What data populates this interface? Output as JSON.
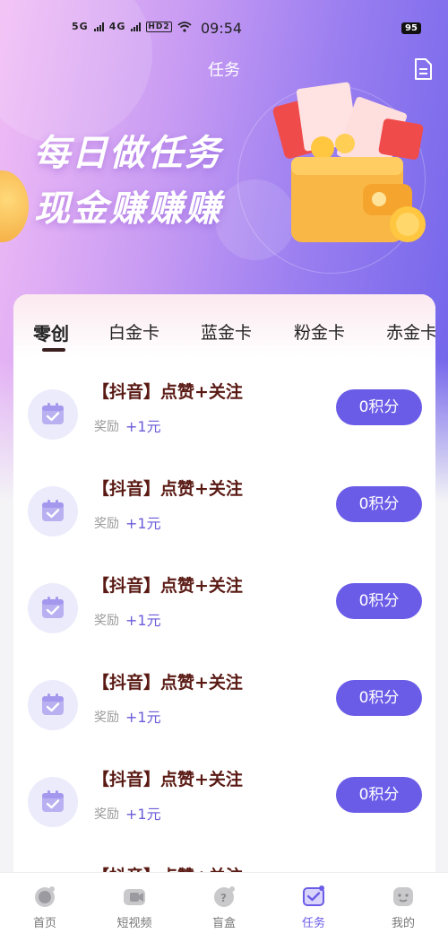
{
  "status_bar": {
    "time": "09:54",
    "network": [
      "5G",
      "4G",
      "HD2"
    ],
    "battery": "95"
  },
  "header": {
    "title": "任务",
    "doc_icon": "document-icon"
  },
  "hero": {
    "line1": "每日做任务",
    "line2": "现金赚赚赚"
  },
  "tabs": [
    {
      "label": "零创",
      "active": true
    },
    {
      "label": "白金卡",
      "active": false
    },
    {
      "label": "蓝金卡",
      "active": false
    },
    {
      "label": "粉金卡",
      "active": false
    },
    {
      "label": "赤金卡",
      "active": false
    }
  ],
  "tasks": [
    {
      "title": "【抖音】点赞+关注",
      "reward_label": "奖励",
      "reward_value": "+1元",
      "button": "0积分"
    },
    {
      "title": "【抖音】点赞+关注",
      "reward_label": "奖励",
      "reward_value": "+1元",
      "button": "0积分"
    },
    {
      "title": "【抖音】点赞+关注",
      "reward_label": "奖励",
      "reward_value": "+1元",
      "button": "0积分"
    },
    {
      "title": "【抖音】点赞+关注",
      "reward_label": "奖励",
      "reward_value": "+1元",
      "button": "0积分"
    },
    {
      "title": "【抖音】点赞+关注",
      "reward_label": "奖励",
      "reward_value": "+1元",
      "button": "0积分"
    },
    {
      "title": "【抖音】点赞+关注",
      "reward_label": "",
      "reward_value": "",
      "button": ""
    }
  ],
  "bottom_nav": [
    {
      "label": "首页",
      "icon": "home-icon",
      "active": false
    },
    {
      "label": "短视频",
      "icon": "video-icon",
      "active": false
    },
    {
      "label": "盲盒",
      "icon": "blind-box-icon",
      "active": false
    },
    {
      "label": "任务",
      "icon": "task-icon",
      "active": true
    },
    {
      "label": "我的",
      "icon": "profile-icon",
      "active": false
    }
  ],
  "colors": {
    "accent": "#6b5ce7",
    "task_title": "#5a1a14",
    "hero_gradient_start": "#f2bdf5",
    "hero_gradient_end": "#6f63ea"
  }
}
